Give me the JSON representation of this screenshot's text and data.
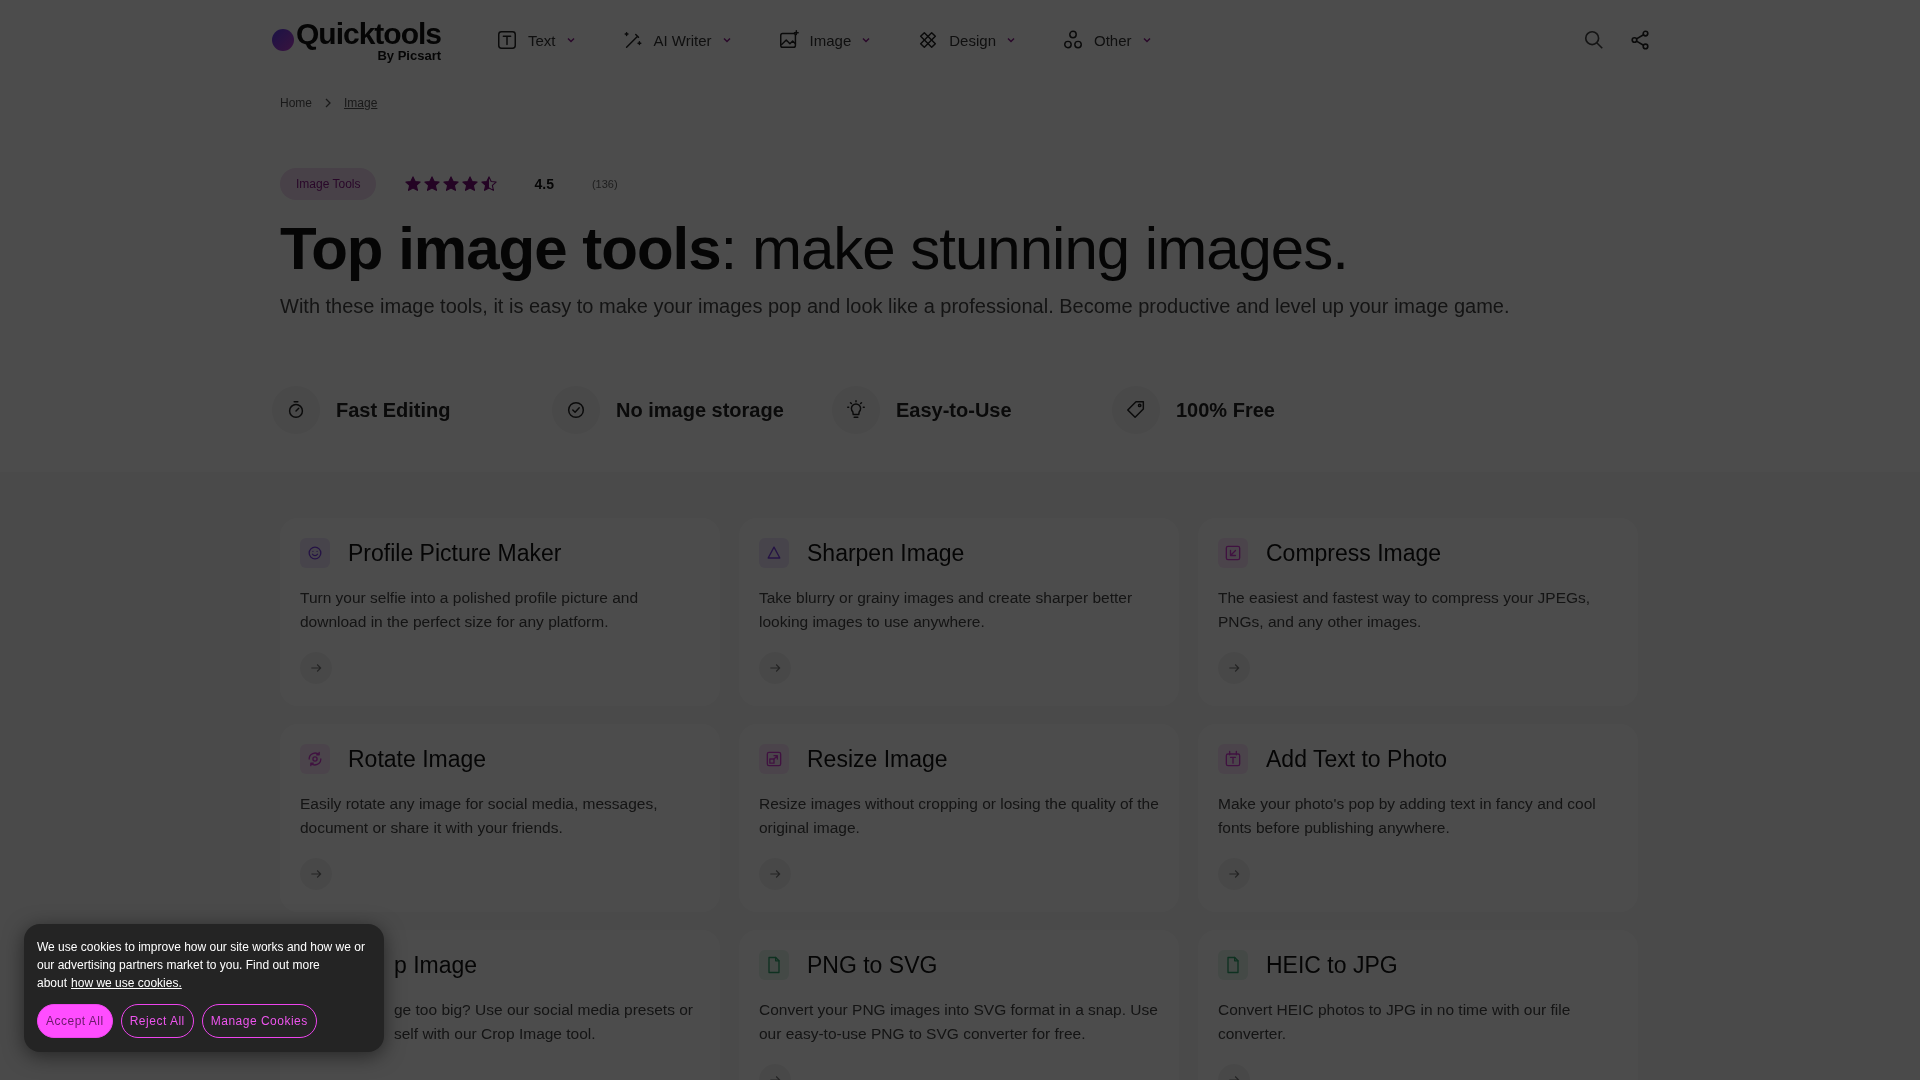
{
  "header": {
    "logo": {
      "name": "Quicktools",
      "byline": "By Picsart"
    },
    "nav": [
      {
        "label": "Text"
      },
      {
        "label": "AI Writer"
      },
      {
        "label": "Image"
      },
      {
        "label": "Design"
      },
      {
        "label": "Other"
      }
    ]
  },
  "breadcrumb": [
    "Home",
    "Image"
  ],
  "hero": {
    "chip": "Image Tools",
    "stars": 4.5,
    "rating": "4.5",
    "count": "(136)",
    "title_bold": "Top image tools",
    "title_rest": ": make stunning images.",
    "subtitle": "With these image tools, it is easy to make your images pop and look like a professional. Become productive and level up your image game."
  },
  "features": [
    {
      "label": "Fast Editing"
    },
    {
      "label": "No image storage"
    },
    {
      "label": "Easy-to-Use"
    },
    {
      "label": "100% Free"
    }
  ],
  "tools": [
    {
      "title": "Profile Picture Maker",
      "description": "Turn your selfie into a polished profile picture and download in the perfect size for any platform.",
      "kind": "full"
    },
    {
      "title": "Sharpen Image",
      "description": "Take blurry or grainy images and create sharper better looking images to use anywhere.",
      "kind": "full"
    },
    {
      "title": "Compress Image",
      "description": "The easiest and fastest way to compress your JPEGs, PNGs, and any other images.",
      "kind": "full"
    },
    {
      "title": "Rotate Image",
      "description": "Easily rotate any image for social media, messages, document or share it with your friends.",
      "kind": "full"
    },
    {
      "title": "Resize Image",
      "description": "Resize images without cropping or losing the quality of the original image.",
      "kind": "full"
    },
    {
      "title": "Add Text to Photo",
      "description": "Make your photo's pop by adding text in fancy and cool fonts before publishing anywhere.",
      "kind": "full"
    },
    {
      "title": "p Image",
      "description": "ge too big? Use our social media presets or self with our Crop Image tool.",
      "kind": "covered"
    },
    {
      "title": "PNG to SVG",
      "description": "Convert your PNG images into SVG format in a snap. Use our easy-to-use PNG to SVG converter for free.",
      "kind": "full"
    },
    {
      "title": "HEIC to JPG",
      "description": "Convert HEIC photos to JPG in no time with our file converter.",
      "kind": "full"
    }
  ],
  "cookie_banner": {
    "text": "We use cookies to improve how our site works and how we or our advertising partners market to you. Find out more about",
    "link": "how we use cookies.",
    "buttons": [
      {
        "label": "Accept All",
        "kind": "primary"
      },
      {
        "label": "Reject All",
        "kind": "outline"
      },
      {
        "label": "Manage Cookies",
        "kind": "outline"
      }
    ]
  }
}
